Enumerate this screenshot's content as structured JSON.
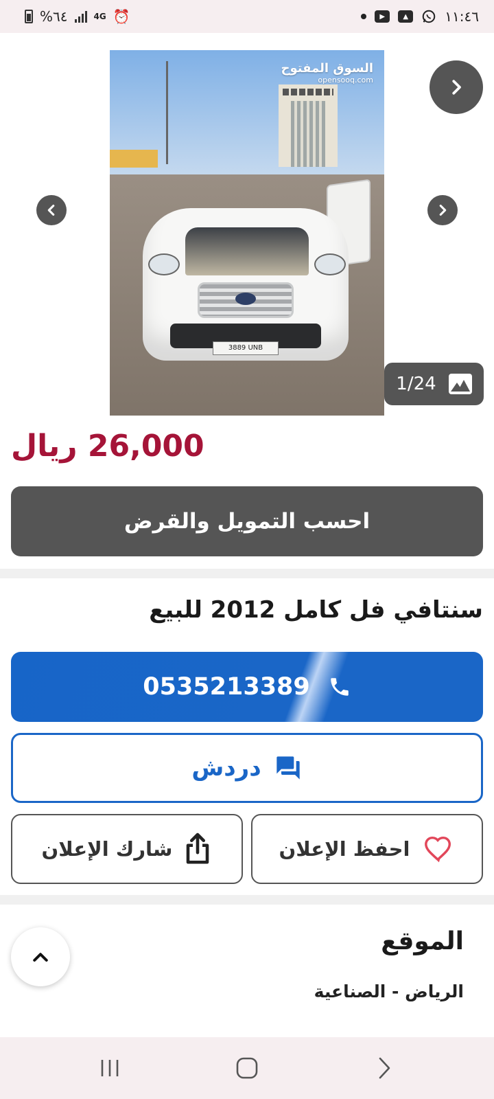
{
  "status_bar": {
    "time": "١١:٤٦",
    "battery": "%٦٤",
    "network": "4G"
  },
  "photo": {
    "watermark_ar": "السوق المفتوح",
    "watermark_en": "opensooq.com",
    "plate_text": "3889 UNB"
  },
  "gallery": {
    "counter": "1/24"
  },
  "listing": {
    "price": "26,000 ريال",
    "finance_label": "احسب التمويل والقرض",
    "title": "سنتافي فل كامل 2012 للبيع"
  },
  "actions": {
    "phone": "0535213389",
    "chat_label": "دردش",
    "save_label": "احفظ الإعلان",
    "share_label": "شارك الإعلان"
  },
  "location": {
    "heading": "الموقع",
    "value": "الرياض - الصناعية"
  },
  "colors": {
    "price": "#a51438",
    "primary": "#1a66c7",
    "dark_button": "#555555",
    "heart": "#e2475a"
  },
  "icons": [
    "chevron-right-icon",
    "chevron-left-icon",
    "image-icon",
    "phone-icon",
    "chat-icon",
    "heart-icon",
    "share-icon",
    "chevron-up-icon",
    "whatsapp-icon",
    "youtube-icon",
    "gallery-icon",
    "alarm-icon"
  ]
}
